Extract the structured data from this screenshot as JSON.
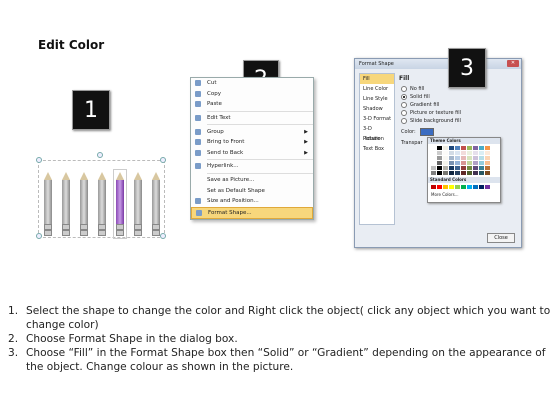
{
  "title": "Edit Color",
  "badges": [
    "1",
    "2",
    "3"
  ],
  "step1": {
    "pencil_count": 7,
    "highlight_color": "#8a4ab5"
  },
  "context_menu": {
    "items": [
      {
        "label": "Cut",
        "icon": "scissors-icon"
      },
      {
        "label": "Copy",
        "icon": "copy-icon"
      },
      {
        "label": "Paste",
        "icon": "paste-icon"
      },
      {
        "label": "Edit Text",
        "icon": "edit-text-icon"
      },
      {
        "label": "Group",
        "icon": "group-icon",
        "submenu": true
      },
      {
        "label": "Bring to Front",
        "icon": "bring-front-icon",
        "submenu": true
      },
      {
        "label": "Send to Back",
        "icon": "send-back-icon",
        "submenu": true
      },
      {
        "label": "Hyperlink...",
        "icon": "hyperlink-icon"
      },
      {
        "label": "Save as Picture...",
        "icon": ""
      },
      {
        "label": "Set as Default Shape",
        "icon": ""
      },
      {
        "label": "Size and Position...",
        "icon": "size-icon"
      },
      {
        "label": "Format Shape...",
        "icon": "format-shape-icon",
        "highlight": true
      }
    ],
    "highlight_color": "#f7d77c"
  },
  "format_dialog": {
    "title": "Format Shape",
    "sidebar": [
      "Fill",
      "Line Color",
      "Line Style",
      "Shadow",
      "3-D Format",
      "3-D Rotation",
      "Picture",
      "Text Box"
    ],
    "heading": "Fill",
    "options": [
      "No fill",
      "Solid fill",
      "Gradient fill",
      "Picture or texture fill",
      "Slide background fill"
    ],
    "selected_option": "Solid fill",
    "color_label": "Color:",
    "transparency_label": "Transpar",
    "palette": {
      "theme_header": "Theme Colors",
      "standard_header": "Standard Colors",
      "more": "More Colors...",
      "theme_colors": [
        "#ffffff",
        "#000000",
        "#eeece1",
        "#1f497d",
        "#4f81bd",
        "#c0504d",
        "#9bbb59",
        "#8064a2",
        "#4bacc6",
        "#f79646"
      ],
      "standard_colors": [
        "#c00000",
        "#ff0000",
        "#ffc000",
        "#ffff00",
        "#92d050",
        "#00b050",
        "#00b0f0",
        "#0070c0",
        "#002060",
        "#7030a0"
      ]
    },
    "close_label": "Close"
  },
  "instructions": [
    {
      "num": "1.",
      "text": "Select the shape to change the color and Right click the object( click any object which you want to change color)"
    },
    {
      "num": "2.",
      "text": "Choose Format Shape in the dialog box."
    },
    {
      "num": "3.",
      "text": "Choose “Fill” in the Format Shape box then “Solid” or “Gradient” depending on the appearance of the object. Change colour as shown in the picture."
    }
  ]
}
